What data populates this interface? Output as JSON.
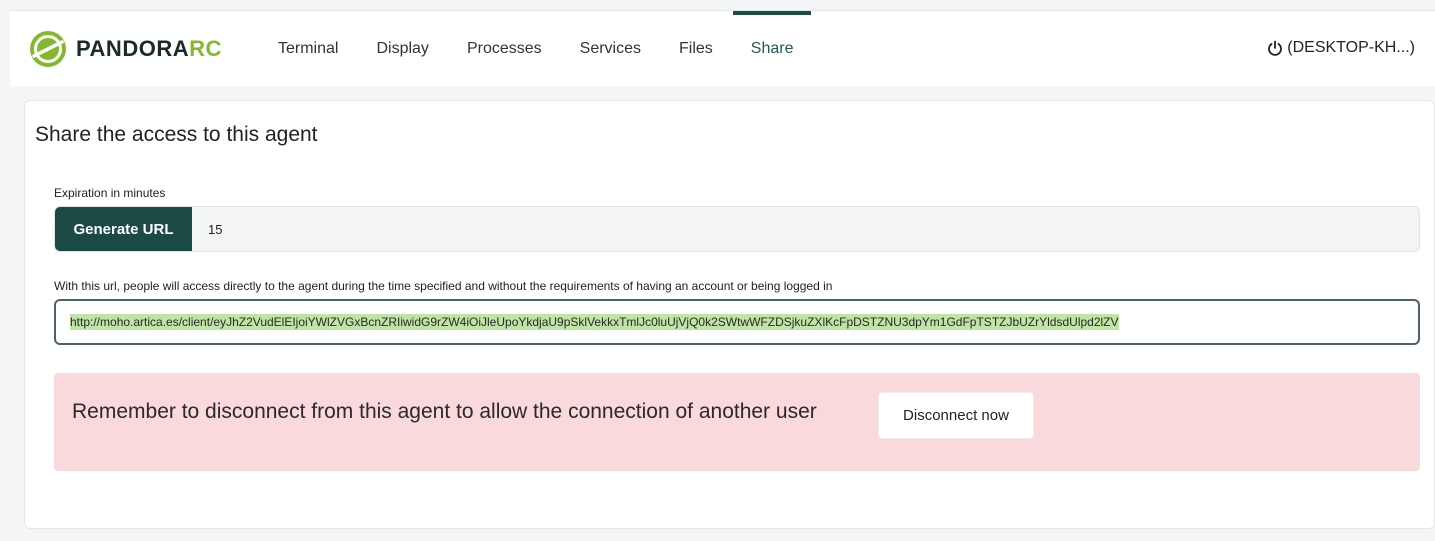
{
  "brand": {
    "name_main": "PANDORA",
    "name_suffix": "RC",
    "accent": "#82b92e",
    "dark": "#1b4a44"
  },
  "nav": {
    "items": [
      {
        "id": "terminal",
        "label": "Terminal"
      },
      {
        "id": "display",
        "label": "Display"
      },
      {
        "id": "processes",
        "label": "Processes"
      },
      {
        "id": "services",
        "label": "Services"
      },
      {
        "id": "files",
        "label": "Files"
      },
      {
        "id": "share",
        "label": "Share",
        "active": true
      }
    ]
  },
  "user": {
    "icon": "power-icon",
    "label": "(DESKTOP-KH...)"
  },
  "share": {
    "title": "Share the access to this agent",
    "expiration_label": "Expiration in minutes",
    "generate_label": "Generate URL",
    "minutes_value": "15",
    "url_label": "With this url, people will access directly to the agent during the time specified and without the requirements of having an account or being logged in",
    "url_value": "http://moho.artica.es/client/eyJhZ2VudElEIjoiYWlZVGxBcnZRIiwidG9rZW4iOiJleUpoYkdjaU9pSklVekkxTmlJc0luUjVjQ0k2SWtwWFZDSjkuZXlKcFpDSTZNU3dpYm1GdFpTSTZJbUZrYldsdUlpd2lZV"
  },
  "alert": {
    "message": "Remember to disconnect from this agent to allow the connection of another user",
    "button_label": "Disconnect now",
    "bg": "#f9d9dc"
  }
}
